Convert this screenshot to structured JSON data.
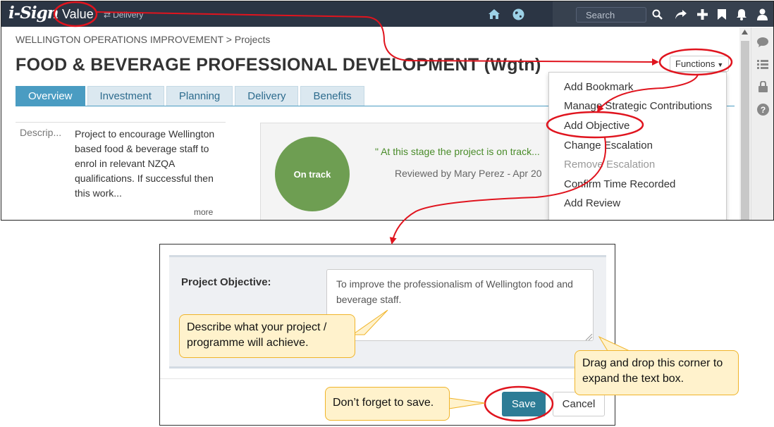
{
  "app": {
    "logo": "i-Sign",
    "module": "Value",
    "submodule": "Delivery"
  },
  "search": {
    "placeholder": "Search"
  },
  "breadcrumb": "WELLINGTON OPERATIONS IMPROVEMENT > Projects",
  "title": "FOOD & BEVERAGE PROFESSIONAL DEVELOPMENT (Wgtn)",
  "tabs": [
    {
      "label": "Overview"
    },
    {
      "label": "Investment"
    },
    {
      "label": "Planning"
    },
    {
      "label": "Delivery"
    },
    {
      "label": "Benefits"
    }
  ],
  "description": {
    "label": "Descrip...",
    "text": "Project to encourage Wellington based food & beverage staff to enrol in relevant NZQA qualifications. If successful then this work...",
    "more": "more"
  },
  "status": {
    "badge": "On track",
    "quote": "\" At this stage the project is on track...",
    "reviewed": "Reviewed by Mary Perez - Apr 20"
  },
  "functions": {
    "label": "Functions",
    "items": [
      "Add Bookmark",
      "Manage Strategic Contributions",
      "Add Objective",
      "Change Escalation",
      "Remove Escalation",
      "Confirm Time Recorded",
      "Add Review"
    ]
  },
  "dialog": {
    "field_label": "Project Objective:",
    "value": "To improve the professionalism of Wellington food and beverage staff.",
    "save": "Save",
    "cancel": "Cancel"
  },
  "callouts": {
    "describe": "Describe what your project / programme will achieve.",
    "drag": "Drag and drop this corner to expand the text box.",
    "save": "Don’t forget to save."
  },
  "colors": {
    "accent": "#4a9cc2",
    "topbar": "#2b3544",
    "status_green": "#6e9e52",
    "annotation_red": "#e0141e",
    "callout_bg": "#fff2cc"
  }
}
